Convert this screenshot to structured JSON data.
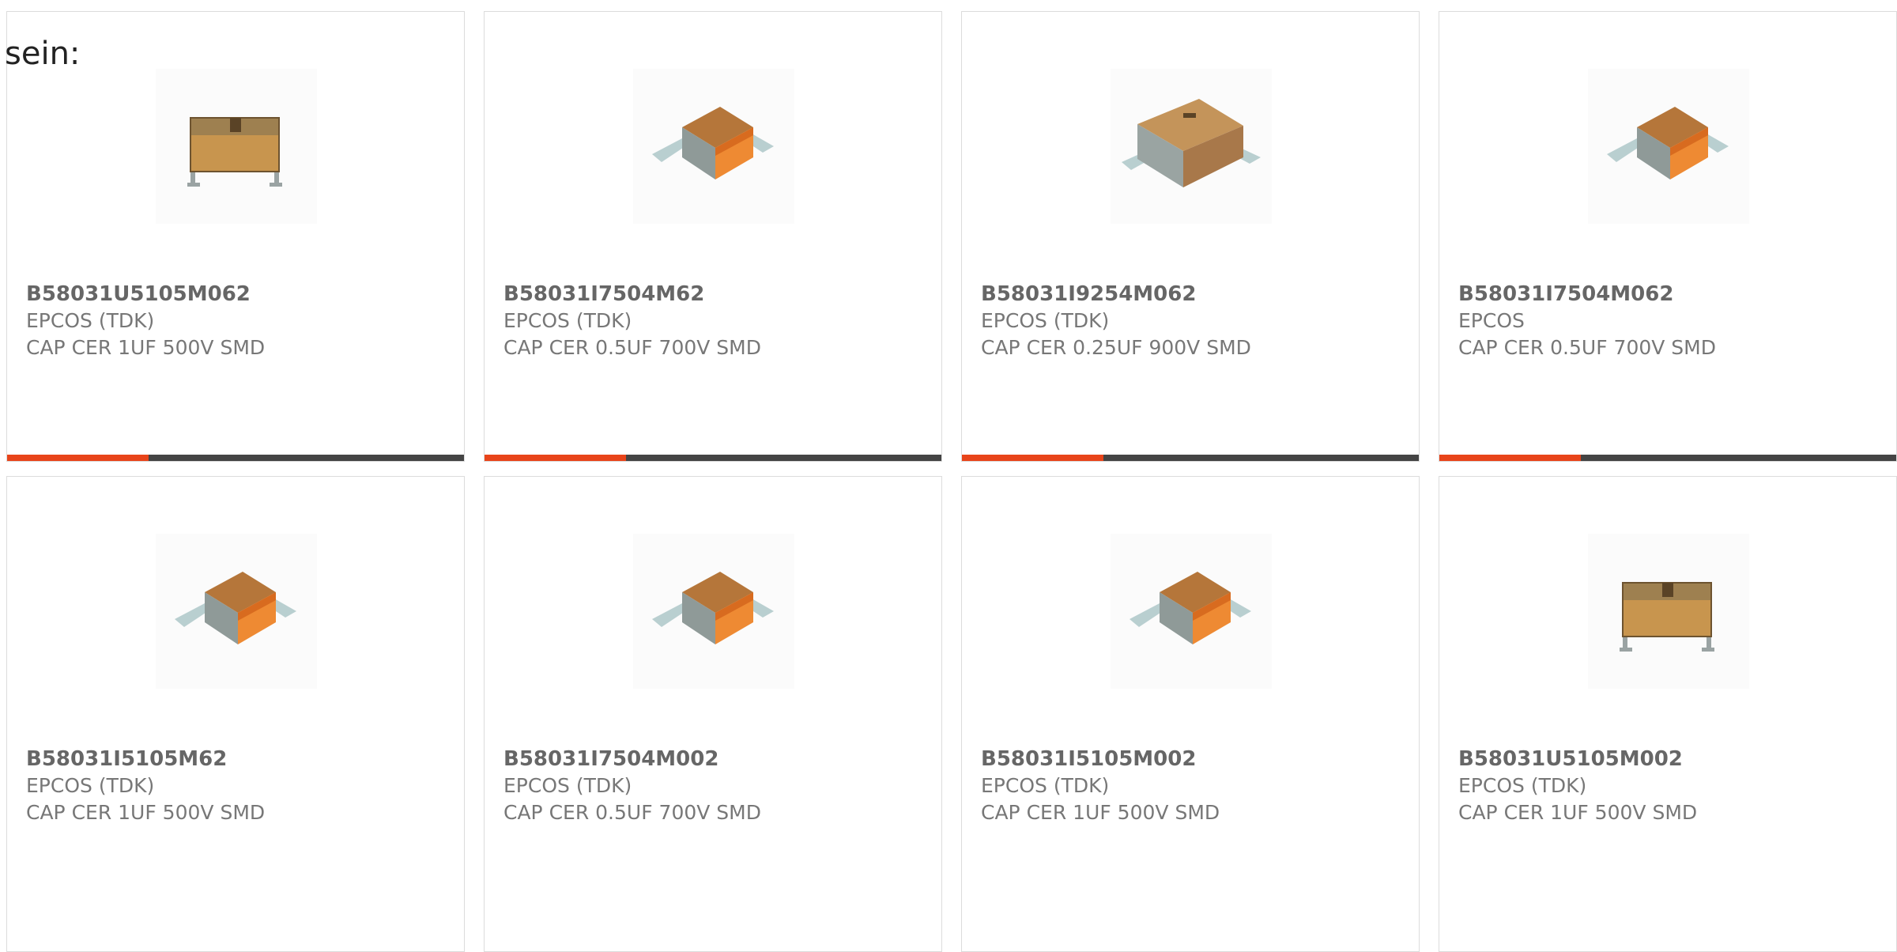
{
  "intro_text": "sein:",
  "accent_color": "#e8441a",
  "bar_track_color": "#444444",
  "products": [
    {
      "part_number": "B58031U5105M062",
      "manufacturer": "EPCOS (TDK)",
      "description": "CAP CER 1UF 500V SMD",
      "image": "capacitor-front-view",
      "progress": 0.31
    },
    {
      "part_number": "B58031I7504M62",
      "manufacturer": "EPCOS (TDK)",
      "description": "CAP CER 0.5UF 700V SMD",
      "image": "capacitor-iso-orange",
      "progress": 0.31
    },
    {
      "part_number": "B58031I9254M062",
      "manufacturer": "EPCOS (TDK)",
      "description": "CAP CER 0.25UF 900V SMD",
      "image": "capacitor-iso-brown",
      "progress": 0.31
    },
    {
      "part_number": "B58031I7504M062",
      "manufacturer": "EPCOS",
      "description": "CAP CER 0.5UF 700V SMD",
      "image": "capacitor-iso-orange",
      "progress": 0.31
    },
    {
      "part_number": "B58031I5105M62",
      "manufacturer": "EPCOS (TDK)",
      "description": "CAP CER 1UF 500V SMD",
      "image": "capacitor-iso-orange"
    },
    {
      "part_number": "B58031I7504M002",
      "manufacturer": "EPCOS (TDK)",
      "description": "CAP CER 0.5UF 700V SMD",
      "image": "capacitor-iso-orange"
    },
    {
      "part_number": "B58031I5105M002",
      "manufacturer": "EPCOS (TDK)",
      "description": "CAP CER 1UF 500V SMD",
      "image": "capacitor-iso-orange"
    },
    {
      "part_number": "B58031U5105M002",
      "manufacturer": "EPCOS (TDK)",
      "description": "CAP CER 1UF 500V SMD",
      "image": "capacitor-front-view"
    }
  ]
}
